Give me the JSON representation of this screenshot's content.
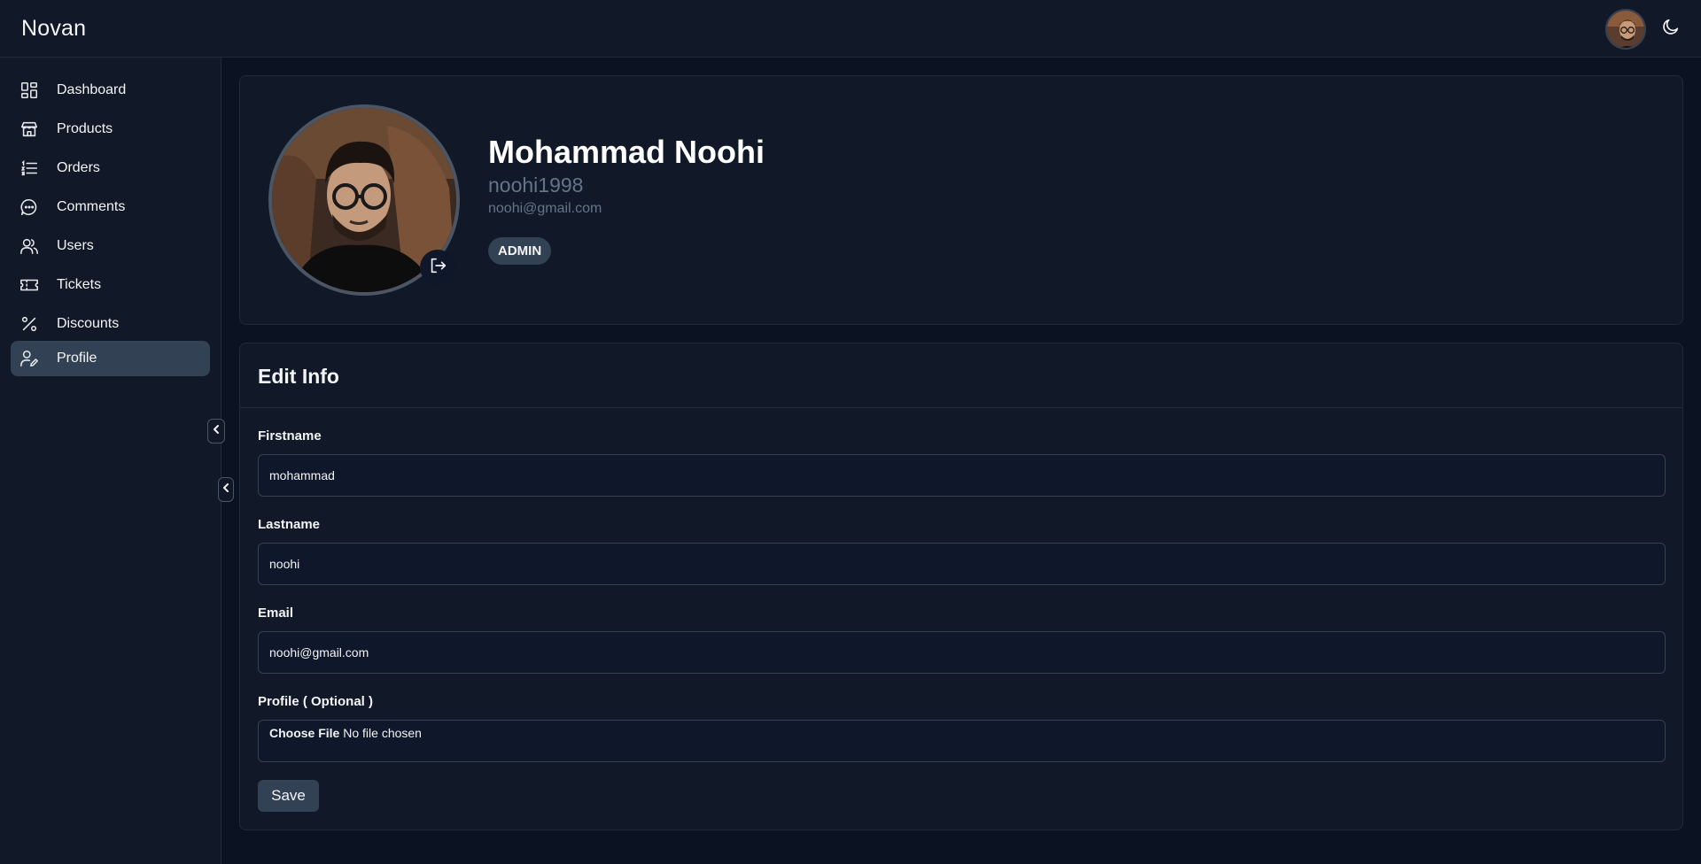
{
  "app": {
    "brand": "Novan"
  },
  "sidebar": {
    "items": [
      {
        "label": "Dashboard",
        "icon": "dashboard-icon"
      },
      {
        "label": "Products",
        "icon": "store-icon"
      },
      {
        "label": "Orders",
        "icon": "list-icon"
      },
      {
        "label": "Comments",
        "icon": "chat-icon"
      },
      {
        "label": "Users",
        "icon": "users-icon"
      },
      {
        "label": "Tickets",
        "icon": "ticket-icon"
      },
      {
        "label": "Discounts",
        "icon": "percent-icon"
      },
      {
        "label": "Profile",
        "icon": "user-edit-icon",
        "active": true
      }
    ]
  },
  "profile": {
    "name": "Mohammad Noohi",
    "username": "noohi1998",
    "email": "noohi@gmail.com",
    "role": "ADMIN"
  },
  "edit": {
    "title": "Edit Info",
    "firstname_label": "Firstname",
    "firstname_value": "mohammad",
    "lastname_label": "Lastname",
    "lastname_value": "noohi",
    "email_label": "Email",
    "email_value": "noohi@gmail.com",
    "profile_label": "Profile ( Optional )",
    "file_button": "Choose File",
    "file_status": "No file chosen",
    "save_label": "Save"
  },
  "colors": {
    "background": "#0b1221",
    "panel": "#111827",
    "active": "#334155",
    "muted_text": "#64748b"
  }
}
